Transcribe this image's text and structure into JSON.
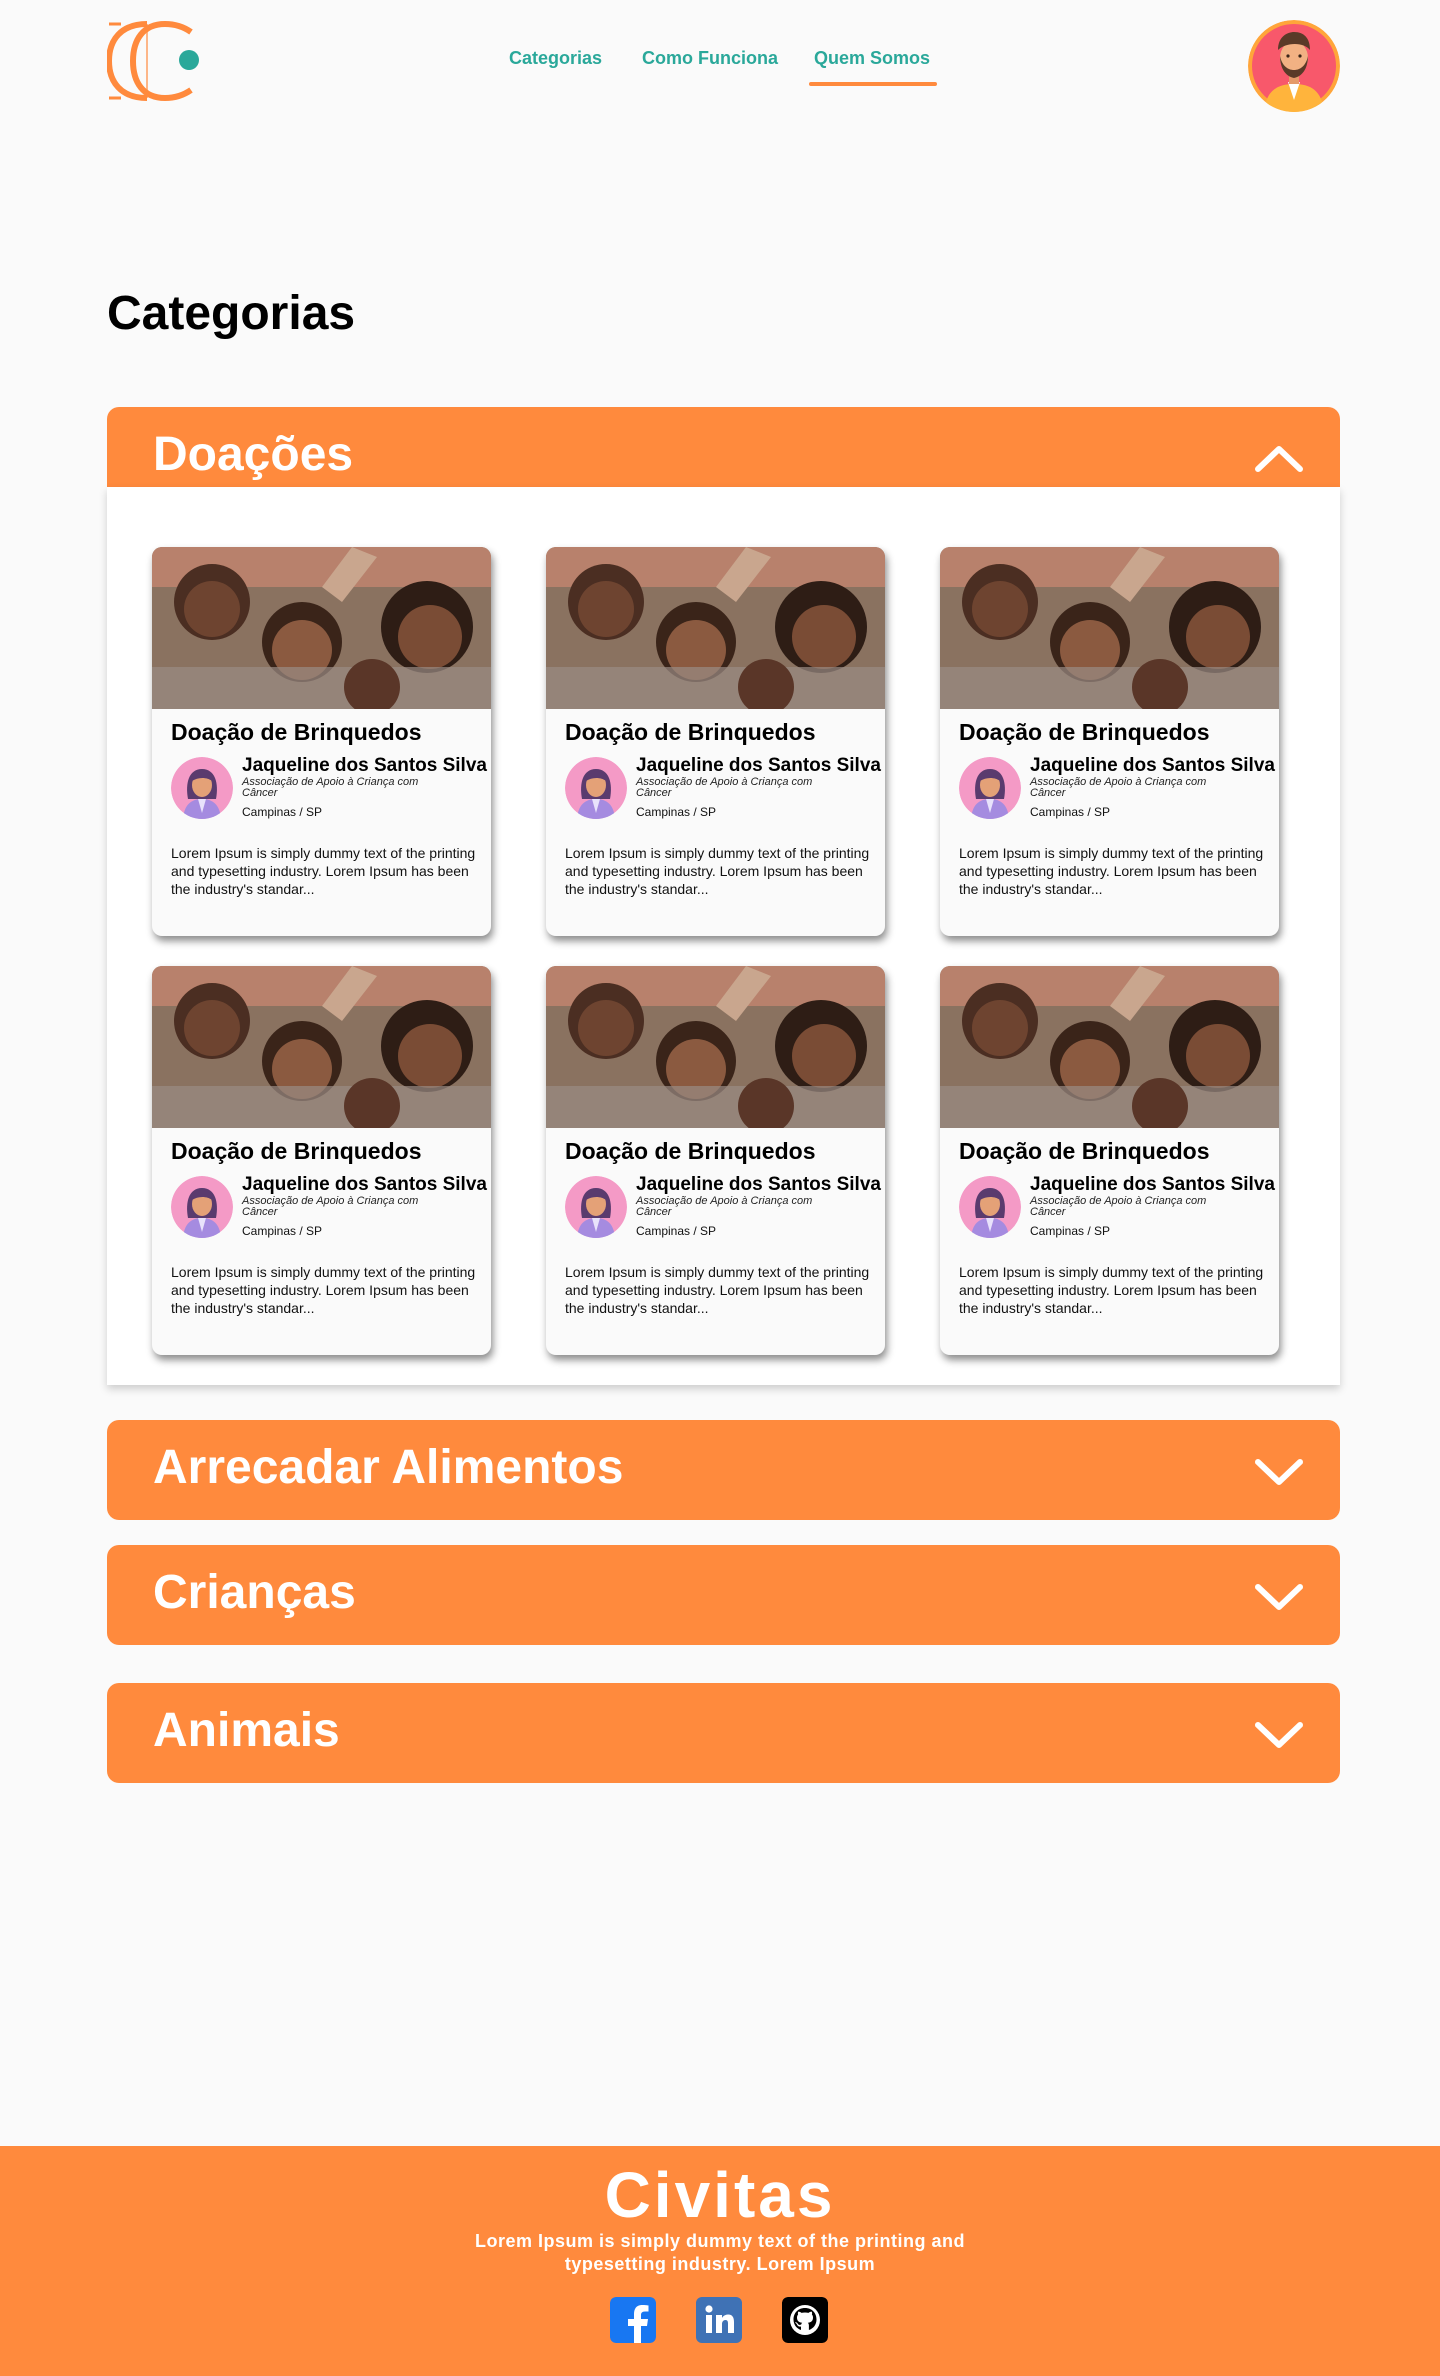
{
  "header": {
    "nav": [
      {
        "label": "Categorias"
      },
      {
        "label": "Como Funciona"
      },
      {
        "label": "Quem Somos"
      }
    ],
    "active_nav": "Quem Somos"
  },
  "page": {
    "title": "Categorias"
  },
  "categories": [
    {
      "title": "Doações",
      "expanded": true,
      "icon": "chevron-up-icon"
    },
    {
      "title": "Arrecadar Alimentos",
      "expanded": false,
      "icon": "chevron-down-icon"
    },
    {
      "title": "Crianças",
      "expanded": false,
      "icon": "chevron-down-icon"
    },
    {
      "title": "Animais",
      "expanded": false,
      "icon": "chevron-down-icon"
    }
  ],
  "cards": [
    {
      "title": "Doação de Brinquedos",
      "name": "Jaqueline dos Santos Silva",
      "org": "Associação de Apoio à Criança com Câncer",
      "location": "Campinas / SP",
      "description": "Lorem Ipsum is simply dummy text of the printing and typesetting industry. Lorem Ipsum has been the industry's standar..."
    },
    {
      "title": "Doação de Brinquedos",
      "name": "Jaqueline dos Santos Silva",
      "org": "Associação de Apoio à Criança com Câncer",
      "location": "Campinas / SP",
      "description": "Lorem Ipsum is simply dummy text of the printing and typesetting industry. Lorem Ipsum has been the industry's standar..."
    },
    {
      "title": "Doação de Brinquedos",
      "name": "Jaqueline dos Santos Silva",
      "org": "Associação de Apoio à Criança com Câncer",
      "location": "Campinas / SP",
      "description": "Lorem Ipsum is simply dummy text of the printing and typesetting industry. Lorem Ipsum has been the industry's standar..."
    },
    {
      "title": "Doação de Brinquedos",
      "name": "Jaqueline dos Santos Silva",
      "org": "Associação de Apoio à Criança com Câncer",
      "location": "Campinas / SP",
      "description": "Lorem Ipsum is simply dummy text of the printing and typesetting industry. Lorem Ipsum has been the industry's standar..."
    },
    {
      "title": "Doação de Brinquedos",
      "name": "Jaqueline dos Santos Silva",
      "org": "Associação de Apoio à Criança com Câncer",
      "location": "Campinas / SP",
      "description": "Lorem Ipsum is simply dummy text of the printing and typesetting industry. Lorem Ipsum has been the industry's standar..."
    },
    {
      "title": "Doação de Brinquedos",
      "name": "Jaqueline dos Santos Silva",
      "org": "Associação de Apoio à Criança com Câncer",
      "location": "Campinas / SP",
      "description": "Lorem Ipsum is simply dummy text of the printing and typesetting industry. Lorem Ipsum has been the industry's standar..."
    }
  ],
  "footer": {
    "brand": "Civitas",
    "tagline": "Lorem Ipsum is simply dummy text of the printing and typesetting industry. Lorem Ipsum",
    "social": [
      "facebook-icon",
      "linkedin-icon",
      "github-icon"
    ]
  },
  "colors": {
    "accent": "#ff8a3d",
    "nav_link": "#2aa89a",
    "background": "#fafafa"
  }
}
